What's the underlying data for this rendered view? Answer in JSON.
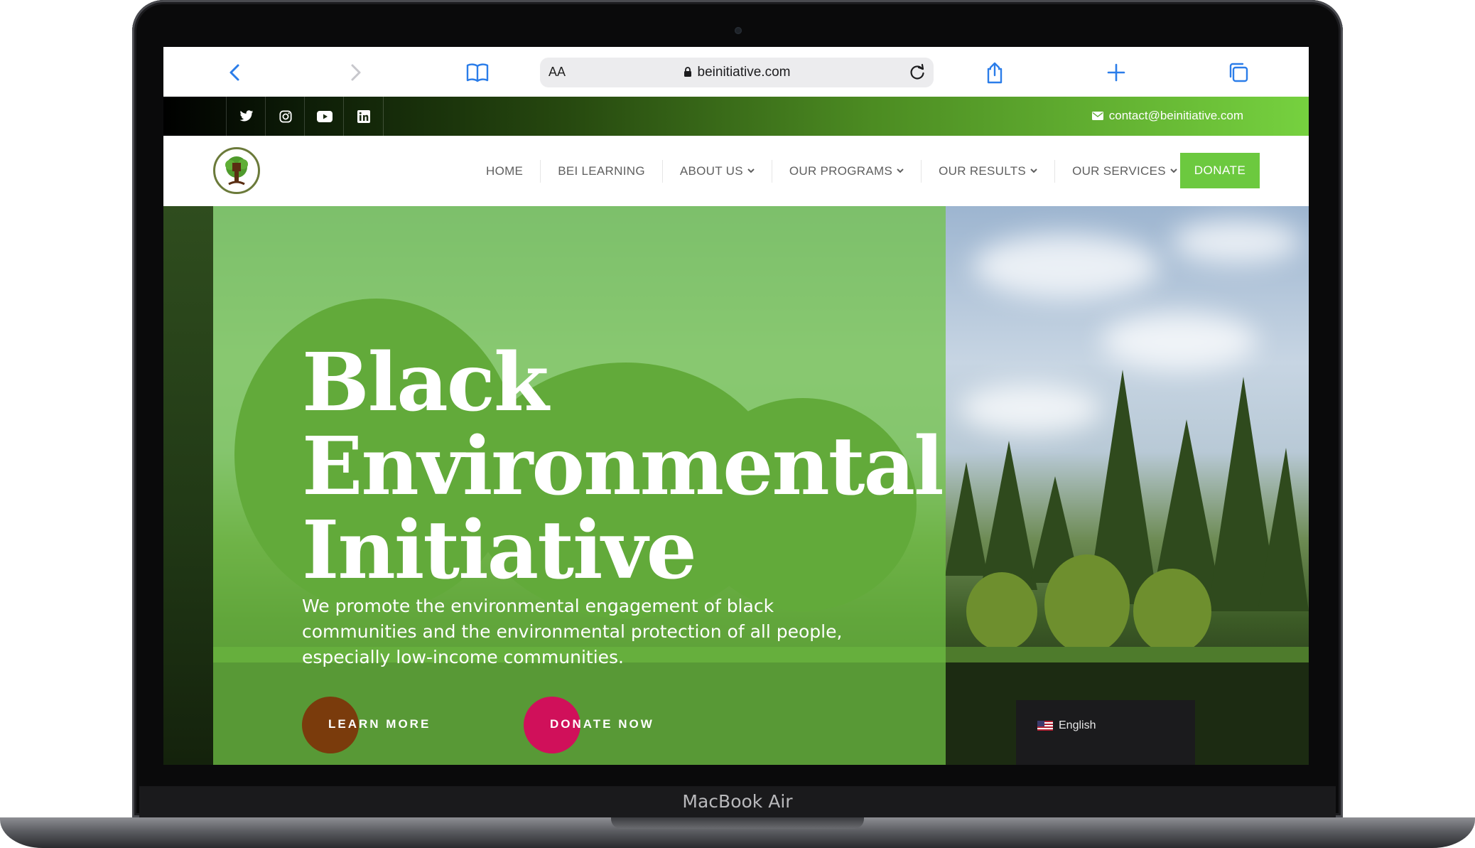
{
  "device": {
    "label": "MacBook Air"
  },
  "browser": {
    "text_size_label": "AA",
    "url": "beinitiative.com"
  },
  "topbar": {
    "social": [
      "twitter",
      "instagram",
      "youtube",
      "linkedin"
    ],
    "contact_email": "contact@beinitiative.com"
  },
  "nav": {
    "items": [
      {
        "label": "HOME",
        "dropdown": false
      },
      {
        "label": "BEI LEARNING",
        "dropdown": false
      },
      {
        "label": "ABOUT US",
        "dropdown": true
      },
      {
        "label": "OUR PROGRAMS",
        "dropdown": true
      },
      {
        "label": "OUR RESULTS",
        "dropdown": true
      },
      {
        "label": "OUR SERVICES",
        "dropdown": true
      }
    ],
    "donate_label": "DONATE"
  },
  "hero": {
    "title_lines": [
      "Black",
      "Environmental",
      "Initiative"
    ],
    "subtitle": "We promote the environmental engagement of black communities and the environmental protection of all people, especially low-income communities.",
    "learn_more_label": "LEARN MORE",
    "donate_now_label": "DONATE NOW"
  },
  "language": {
    "label": "English"
  },
  "colors": {
    "accent_green": "#6cc93f",
    "learn_more": "#7a3b0c",
    "donate_now": "#d0105a"
  }
}
